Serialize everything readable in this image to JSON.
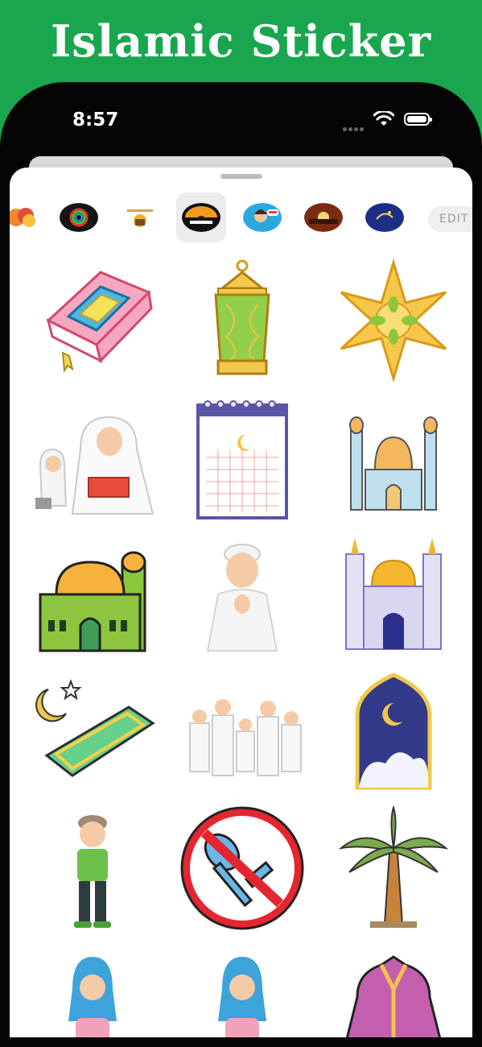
{
  "banner": {
    "title": "Islamic Sticker"
  },
  "status_bar": {
    "time": "8:57"
  },
  "pack_bar": {
    "packs": [
      "emoji-faces-pack",
      "ring-pack",
      "ramadan-text-pack",
      "islamic-stickers-pack",
      "girl-pack",
      "sunset-pack",
      "greeting-pack"
    ],
    "selected_index": 3,
    "edit_label": "EDIT"
  },
  "stickers": [
    "quran-book",
    "lantern",
    "star",
    "mother-child-reading",
    "ramadan-calendar",
    "blue-mosque",
    "green-mosque",
    "praying-boy",
    "purple-mosque",
    "prayer-mat-moon",
    "family-group",
    "moon-arch",
    "standing-boy",
    "no-eating-sign",
    "palm-tree",
    "girl-hijab-1",
    "girl-hijab-2",
    "purple-robe"
  ],
  "colors": {
    "brand_green": "#1aa64f",
    "sheet_bg": "#ffffff"
  }
}
